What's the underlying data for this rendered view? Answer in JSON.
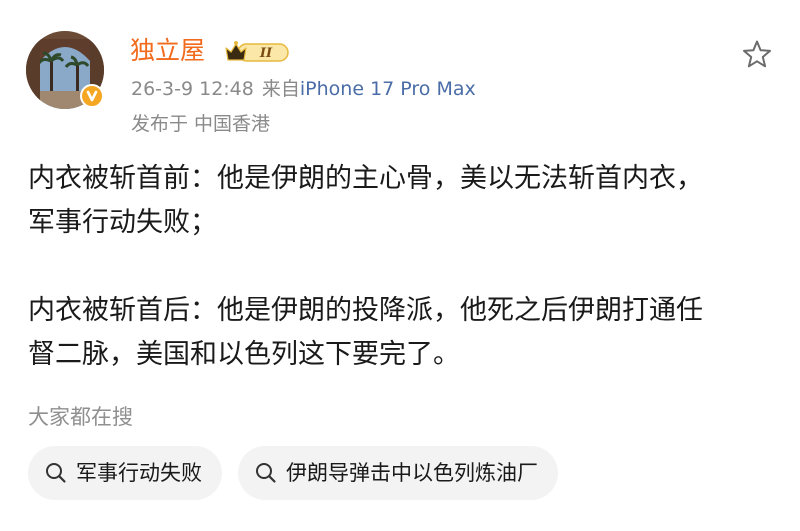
{
  "post": {
    "author": {
      "name": "独立屋",
      "rank_badge_text": "II"
    },
    "timestamp": "26-3-9 12:48",
    "source_prefix": "来自",
    "device": "iPhone 17 Pro Max",
    "location": "发布于 中国香港",
    "content": {
      "paragraph1_line1": "内衣被斩首前：他是伊朗的主心骨，美以无法斩首内衣，",
      "paragraph1_line2": "军事行动失败；",
      "paragraph2_line1": "内衣被斩首后：他是伊朗的投降派，他死之后伊朗打通任",
      "paragraph2_line2": "督二脉，美国和以色列这下要完了。"
    }
  },
  "related_search": {
    "heading": "大家都在搜",
    "chips": [
      {
        "label": "军事行动失败",
        "icon": "search-icon"
      },
      {
        "label": "伊朗导弹击中以色列炼油厂",
        "icon": "search-icon"
      }
    ]
  },
  "colors": {
    "username": "#f26a1b",
    "device_link": "#4a6da7",
    "meta_text": "#8a8a8a",
    "chip_bg": "#f3f3f3",
    "verified_badge": "#f5a623",
    "rank_badge_gold": "#f2c94c"
  }
}
